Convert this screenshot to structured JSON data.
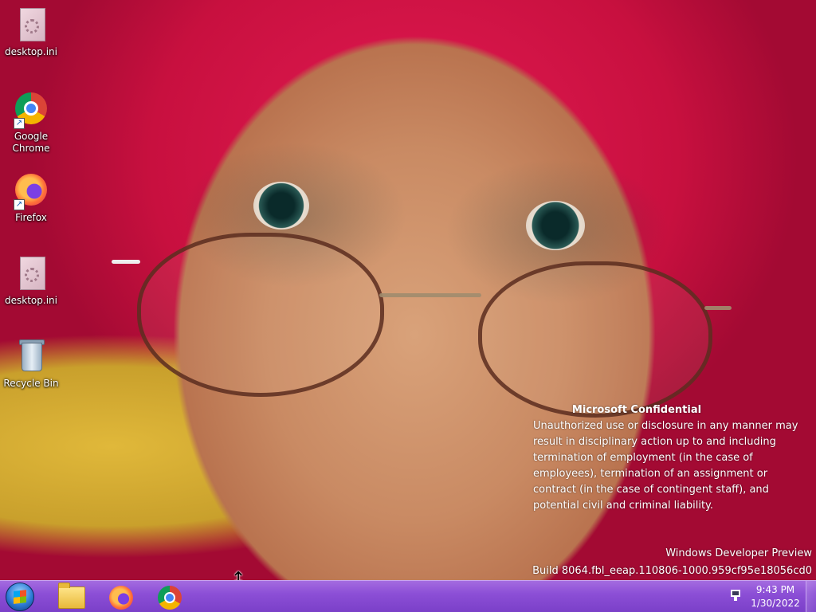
{
  "desktop": {
    "icons": [
      {
        "label": "desktop.ini",
        "icon": "settings-file-icon"
      },
      {
        "label": "Google Chrome",
        "icon": "chrome-icon"
      },
      {
        "label": "Firefox",
        "icon": "firefox-icon"
      },
      {
        "label": "desktop.ini",
        "icon": "settings-file-icon"
      },
      {
        "label": "Recycle Bin",
        "icon": "recycle-bin-icon"
      }
    ]
  },
  "watermark": {
    "title": "Microsoft Confidential",
    "body": "Unauthorized use or disclosure in any manner may result in disciplinary action up to and including termination of employment (in the case of employees), termination of an assignment or contract (in the case of contingent staff), and potential civil and criminal liability.",
    "edition": "Windows Developer Preview",
    "build": "Build 8064.fbl_eeap.110806-1000.959cf95e18056cd0"
  },
  "taskbar": {
    "pinned": [
      {
        "name": "start-button",
        "icon": "windows-logo-icon"
      },
      {
        "name": "file-explorer",
        "icon": "folder-icon"
      },
      {
        "name": "firefox",
        "icon": "firefox-icon"
      },
      {
        "name": "chrome",
        "icon": "chrome-icon"
      }
    ],
    "tray": {
      "network_icon": "network-icon"
    },
    "clock": {
      "time": "9:43 PM",
      "date": "1/30/2022"
    }
  },
  "cursor": {
    "icon": "vertical-resize-cursor-icon"
  },
  "colors": {
    "taskbar": "#8c4fd6",
    "wallpaper_primary": "#c8103f",
    "text": "#ffffff"
  }
}
